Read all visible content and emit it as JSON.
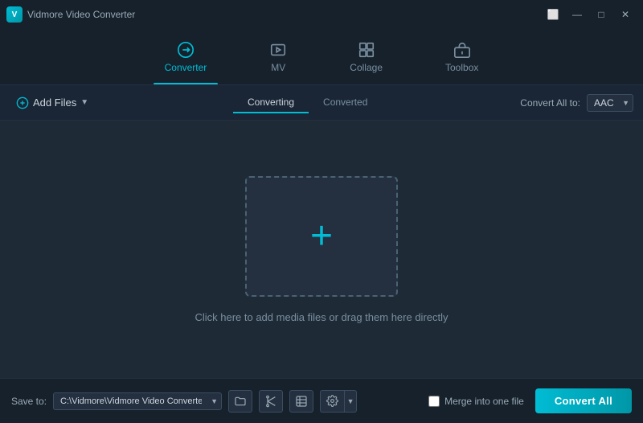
{
  "titleBar": {
    "appName": "Vidmore Video Converter",
    "windowControls": {
      "minimize": "—",
      "maximize": "□",
      "close": "✕",
      "captionBtn": "⬜"
    }
  },
  "navTabs": [
    {
      "id": "converter",
      "label": "Converter",
      "active": true
    },
    {
      "id": "mv",
      "label": "MV",
      "active": false
    },
    {
      "id": "collage",
      "label": "Collage",
      "active": false
    },
    {
      "id": "toolbox",
      "label": "Toolbox",
      "active": false
    }
  ],
  "toolbar": {
    "addFilesLabel": "Add Files",
    "statusTabs": [
      "Converting",
      "Converted"
    ],
    "activeStatusTab": "Converting",
    "convertAllToLabel": "Convert All to:",
    "selectedFormat": "AAC"
  },
  "mainContent": {
    "dropHint": "Click here to add media files or drag them here directly"
  },
  "footer": {
    "saveToLabel": "Save to:",
    "savePath": "C:\\Vidmore\\Vidmore Video Converter\\Converted",
    "mergeLabel": "Merge into one file",
    "convertAllLabel": "Convert All"
  }
}
